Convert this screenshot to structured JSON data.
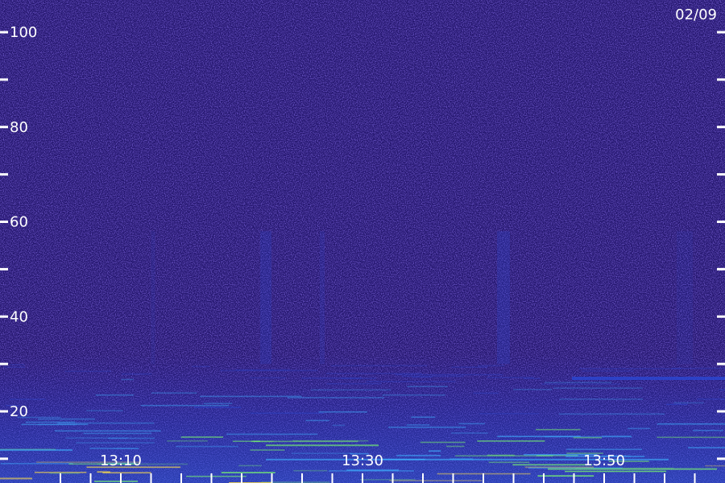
{
  "chart_data": {
    "type": "heatmap",
    "date_label": "02/09",
    "y_tick_labels": [
      "100",
      "80",
      "60",
      "40",
      "20"
    ],
    "y_ticks": [
      100,
      90,
      80,
      70,
      60,
      50,
      40,
      30,
      20,
      10
    ],
    "ylim": [
      5,
      105
    ],
    "x_tick_labels": [
      "13:10",
      "13:30",
      "13:50"
    ],
    "x_ticks_minutes": [
      "13:05",
      "13:07:30",
      "13:10",
      "13:12:30",
      "13:15",
      "13:17:30",
      "13:20",
      "13:22:30",
      "13:25",
      "13:27:30",
      "13:30",
      "13:32:30",
      "13:35",
      "13:37:30",
      "13:40",
      "13:42:30",
      "13:45",
      "13:47:30",
      "13:50",
      "13:52:30",
      "13:55",
      "13:57:30"
    ],
    "xlim": [
      "13:00",
      "14:00"
    ],
    "colors": {
      "background": "#2a1a7a",
      "noise_low": "#1a0f55",
      "noise_high": "#4a2fc0",
      "band_blue": "#2a4ad8",
      "band_cyan": "#3fb0ff",
      "band_green": "#7cff6a",
      "band_yellow": "#ffe04a",
      "axis": "#ffffff"
    }
  }
}
